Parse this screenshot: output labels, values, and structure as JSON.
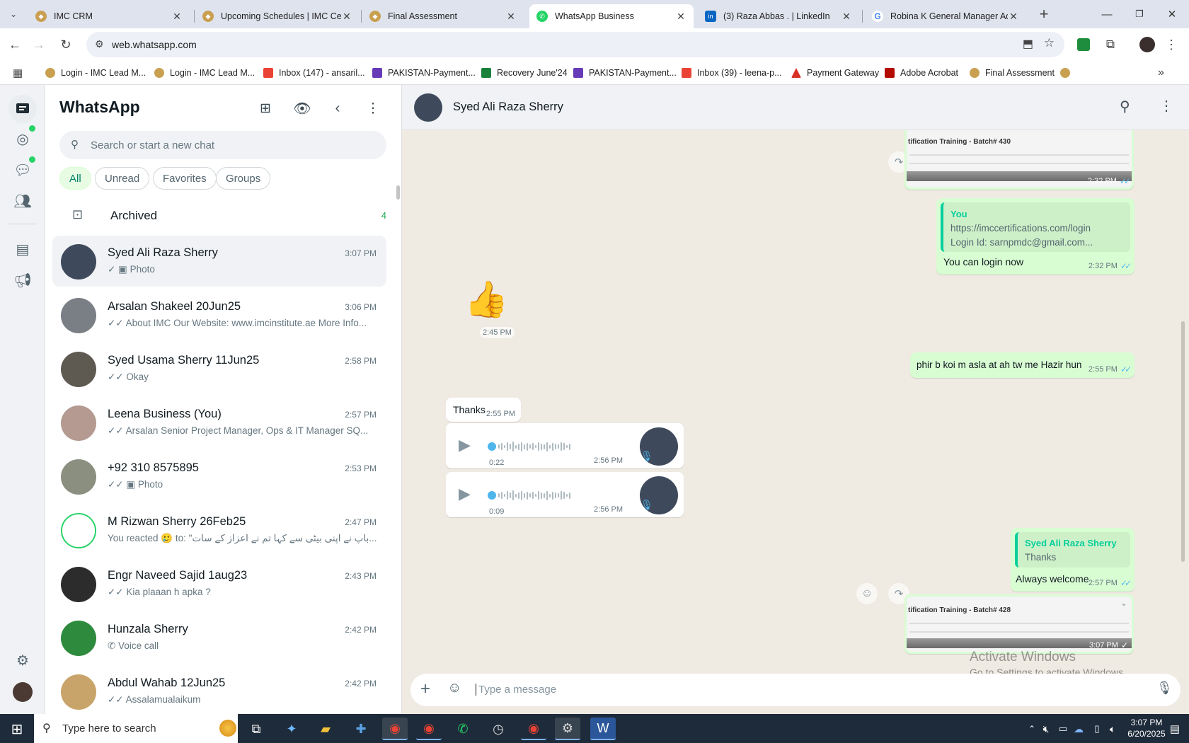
{
  "browser": {
    "tabs": [
      {
        "label": "IMC CRM",
        "icon": "imc-favicon"
      },
      {
        "label": "Upcoming Schedules | IMC Cert",
        "icon": "imc-favicon"
      },
      {
        "label": "Final Assessment",
        "icon": "imc-favicon"
      },
      {
        "label": "WhatsApp Business",
        "icon": "whatsapp-favicon"
      },
      {
        "label": "(3) Raza Abbas . | LinkedIn",
        "icon": "linkedin-favicon"
      },
      {
        "label": "Robina K General Manager Adv",
        "icon": "google-favicon"
      }
    ],
    "url": "web.whatsapp.com",
    "bookmarks": [
      "Login - IMC Lead M...",
      "Login - IMC Lead M...",
      "Inbox (147) - ansaril...",
      "PAKISTAN-Payment...",
      "Recovery June'24",
      "PAKISTAN-Payment...",
      "Inbox (39) - leena-p...",
      "Payment Gateway",
      "Adobe Acrobat",
      "Final Assessment"
    ]
  },
  "sidebar": {
    "title": "WhatsApp",
    "search_placeholder": "Search or start a new chat",
    "filters": [
      "All",
      "Unread",
      "Favorites",
      "Groups"
    ],
    "archived_label": "Archived",
    "archived_count": "4",
    "chats": [
      {
        "name": "Syed Ali Raza Sherry",
        "time": "3:07 PM",
        "preview": "✓ ▣ Photo",
        "color": "#3e4a5c"
      },
      {
        "name": "Arsalan Shakeel 20Jun25",
        "time": "3:06 PM",
        "preview": "✓✓ About IMC Our Website: www.imcinstitute.ae More Info...",
        "color": "#7a7f85"
      },
      {
        "name": "Syed Usama Sherry 11Jun25",
        "time": "2:58 PM",
        "preview": "✓✓ Okay",
        "color": "#5e5a52"
      },
      {
        "name": "Leena Business (You)",
        "time": "2:57 PM",
        "preview": "✓✓ Arsalan Senior Project Manager, Ops & IT Manager SQ...",
        "color": "#b49a90"
      },
      {
        "name": "+92 310 8575895",
        "time": "2:53 PM",
        "preview": "✓✓ ▣ Photo",
        "color": "#8a8f80"
      },
      {
        "name": "M Rizwan Sherry 26Feb25",
        "time": "2:47 PM",
        "preview": "You reacted 🥲 to: \"باپ نے اپنی بیٹی سے کہا تم نے اعزاز کے سات...\"",
        "color": "#ffffff"
      },
      {
        "name": "Engr Naveed Sajid 1aug23",
        "time": "2:43 PM",
        "preview": "✓✓ Kia plaaan h apka ?",
        "color": "#2c2c2c"
      },
      {
        "name": "Hunzala Sherry",
        "time": "2:42 PM",
        "preview": "✆ Voice call",
        "color": "#2e8a3c"
      },
      {
        "name": "Abdul Wahab 12Jun25",
        "time": "2:42 PM",
        "preview": "✓✓ Assalamualaikum",
        "color": "#c9a46a"
      }
    ]
  },
  "conversation": {
    "contact_name": "Syed Ali Raza Sherry",
    "messages": {
      "img1_title": "tification Training - Batch# 430",
      "img1_time": "2:32 PM",
      "quote_author": "You",
      "quote_line1": "https://imccertifications.com/login",
      "quote_line2": "Login Id: sarnpmdc@gmail.com...",
      "login_text": "You can login now",
      "login_time": "2:32 PM",
      "thumb_emoji": "👍",
      "thumb_time": "2:45 PM",
      "hazir_text": "phir b koi m asla at ah tw me Hazir hun",
      "hazir_time": "2:55 PM",
      "thanks_text": "Thanks",
      "thanks_time": "2:55 PM",
      "voice1_duration": "0:22",
      "voice1_time": "2:56 PM",
      "voice2_duration": "0:09",
      "voice2_time": "2:56 PM",
      "reply_author": "Syed Ali Raza Sherry",
      "reply_quote": "Thanks",
      "welcome_text": "Always welcome",
      "welcome_time": "2:57 PM",
      "img2_title": "tification Training - Batch# 428",
      "img2_time": "3:07 PM"
    },
    "composer_placeholder": "Type a message"
  },
  "watermark": {
    "line1": "Activate Windows",
    "line2": "Go to Settings to activate Windows."
  },
  "taskbar": {
    "search_placeholder": "Type here to search",
    "time": "3:07 PM",
    "date": "6/20/2025"
  }
}
